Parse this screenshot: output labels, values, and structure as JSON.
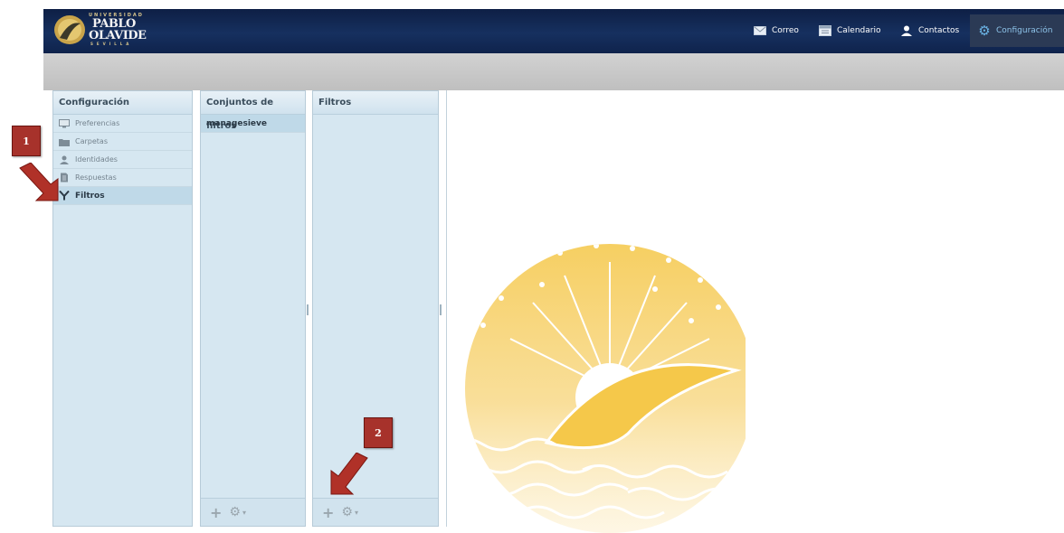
{
  "header": {
    "logo": {
      "line1": "UNIVERSIDAD",
      "line2": "PABLO",
      "line3": "OLAVIDE",
      "line4": "SEVILLA"
    },
    "nav": [
      {
        "label": "Correo",
        "icon": "envelope-icon"
      },
      {
        "label": "Calendario",
        "icon": "calendar-icon"
      },
      {
        "label": "Contactos",
        "icon": "person-icon"
      },
      {
        "label": "Configuración",
        "icon": "gear-icon"
      }
    ]
  },
  "settings_panel": {
    "title": "Configuración",
    "items": [
      {
        "label": "Preferencias",
        "icon": "monitor-icon"
      },
      {
        "label": "Carpetas",
        "icon": "folder-icon"
      },
      {
        "label": "Identidades",
        "icon": "person-icon"
      },
      {
        "label": "Respuestas",
        "icon": "document-icon"
      },
      {
        "label": "Filtros",
        "icon": "filter-icon",
        "selected": true
      }
    ]
  },
  "filtersets_panel": {
    "title": "Conjuntos de filtros",
    "items": [
      {
        "label": "managesieve",
        "selected": true
      }
    ],
    "footer": {
      "add_icon": "plus-icon",
      "actions_icon": "gear-icon"
    }
  },
  "filters_panel": {
    "title": "Filtros",
    "footer": {
      "add_icon": "plus-icon",
      "actions_icon": "gear-icon"
    }
  },
  "annotations": [
    {
      "label": "1"
    },
    {
      "label": "2"
    }
  ],
  "colors": {
    "header": "#16305f",
    "accent": "#8ec4ea",
    "panel": "#d6e7f1",
    "annotation": "#a7322b",
    "watermark": "#f5c84a"
  }
}
